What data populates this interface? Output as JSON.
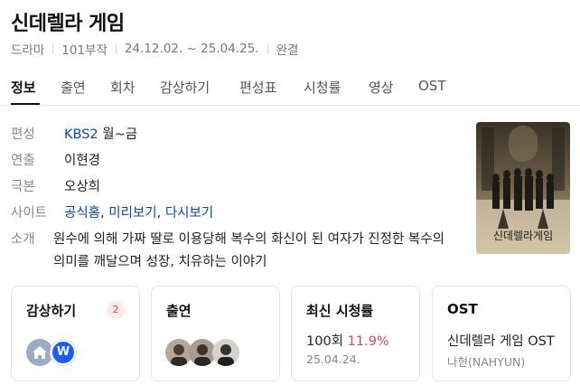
{
  "header": {
    "title": "신데렐라 게임",
    "meta": [
      "드라마",
      "101부작",
      "24.12.02. ~ 25.04.25.",
      "완결"
    ]
  },
  "tabs": [
    {
      "label": "정보",
      "active": true
    },
    {
      "label": "출연"
    },
    {
      "label": "회차"
    },
    {
      "label": "감상하기"
    },
    {
      "label": "편성표"
    },
    {
      "label": "시청률"
    },
    {
      "label": "영상"
    },
    {
      "label": "OST"
    }
  ],
  "info": {
    "broadcast": {
      "label": "편성",
      "channel": "KBS2",
      "days": "월~금"
    },
    "director": {
      "label": "연출",
      "value": "이현경"
    },
    "writer": {
      "label": "극본",
      "value": "오상희"
    },
    "site": {
      "label": "사이트",
      "links": [
        "공식홈",
        "미리보기",
        "다시보기"
      ],
      "separator": ","
    },
    "synopsis": {
      "label": "소개",
      "text": "원수에 의해 가짜 딸로 이용당해 복수의 화신이 된 여자가 진정한 복수의 의미를 깨달으며 성장, 치유하는 이야기"
    }
  },
  "poster": {
    "title_text": "신데렐라게임"
  },
  "cards": {
    "watch": {
      "title": "감상하기",
      "count": "2",
      "icons": [
        "home-service-icon",
        "wavve-icon"
      ],
      "wavve_letter": "W"
    },
    "cast": {
      "title": "출연"
    },
    "rating": {
      "title": "최신 시청률",
      "episode": "100회",
      "value": "11.9%",
      "date": "25.04.24."
    },
    "ost": {
      "title": "OST",
      "song": "신데렐라 게임 OST",
      "artist": "나현(NAHYUN)"
    }
  },
  "colors": {
    "link": "#0846b8",
    "accent_red": "#e5484d",
    "wavve": "#1a5cff"
  }
}
